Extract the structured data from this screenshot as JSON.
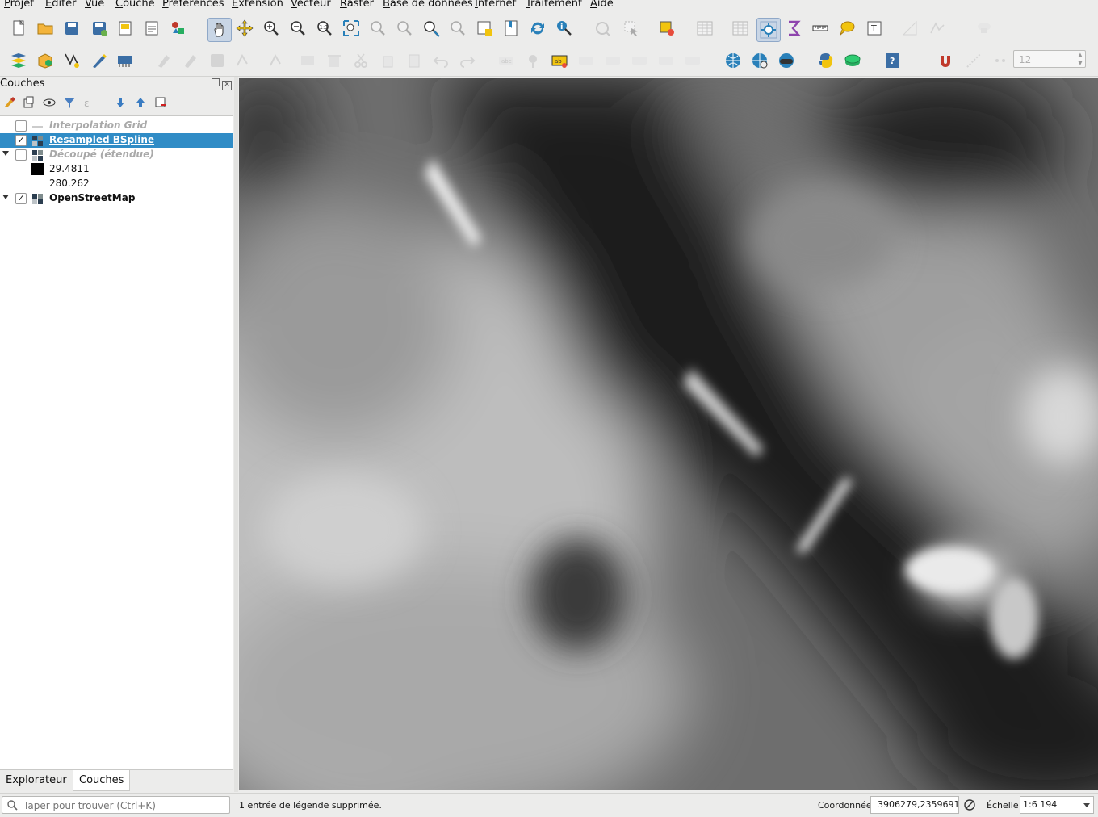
{
  "menu": [
    "Projet",
    "Editer",
    "Vue",
    "Couche",
    "Préférences",
    "Extension",
    "Vecteur",
    "Raster",
    "Base de données",
    "Internet",
    "Traitement",
    "Aide"
  ],
  "toolbar1": [
    "new-project",
    "open-project",
    "save-project",
    "save-as",
    "new-print-layout",
    "layout-manager",
    "style-manager",
    "pan",
    "pan-to-selection",
    "zoom-in",
    "zoom-out",
    "zoom-native",
    "zoom-full",
    "zoom-to-selection",
    "zoom-to-layer",
    "zoom-last",
    "zoom-next",
    "new-bookmark",
    "show-bookmarks",
    "refresh",
    "identify",
    "run-action",
    "select-features",
    "deselect",
    "attribute-table",
    "field-calculator",
    "statistics",
    "measure",
    "map-tips",
    "text-annotation",
    "digitize",
    "vertex-tool",
    "plugin-a",
    "plugin-b"
  ],
  "toolbar2": [
    "add-layer",
    "add-vector",
    "new-shapefile",
    "digitize-pen",
    "data-source",
    "toggle-edit",
    "current-edits",
    "save-edits",
    "add-feature",
    "vertex",
    "modify-attributes",
    "delete",
    "cut",
    "copy",
    "paste",
    "undo",
    "redo",
    "label",
    "pin-label",
    "highlight-label",
    "move-label",
    "rotate-label",
    "change-label",
    "show-hide-label",
    "label-properties",
    "globe",
    "globe-settings",
    "globe-vr",
    "python-console",
    "plugin-layers",
    "help",
    "snapping",
    "snapping-mode",
    "snapping-type"
  ],
  "snapping_tolerance": "12",
  "layers_panel": {
    "title": "Couches",
    "items": [
      {
        "label": "Interpolation Grid",
        "checked": false,
        "greyed": true,
        "selected": false,
        "expanded": null,
        "icon": "line-layer-icon"
      },
      {
        "label": "Resampled BSpline",
        "checked": true,
        "greyed": false,
        "selected": true,
        "expanded": null,
        "icon": "raster-layer-icon"
      },
      {
        "label": "Découpé (étendue)",
        "checked": false,
        "greyed": true,
        "selected": false,
        "expanded": true,
        "icon": "raster-layer-icon"
      },
      {
        "label": "OpenStreetMap",
        "checked": true,
        "greyed": false,
        "selected": false,
        "expanded": true,
        "icon": "raster-layer-icon"
      }
    ],
    "legend": {
      "min": "29.4811",
      "max": "280.262"
    }
  },
  "tabs": [
    "Explorateur",
    "Couches"
  ],
  "search_placeholder": "Taper pour trouver (Ctrl+K)",
  "status_message": "1 entrée de légende supprimée.",
  "coordinate_label": "Coordonnée",
  "coordinate_value": "3906279,2359691",
  "scale_label": "Échelle",
  "scale_value": "1:6 194"
}
